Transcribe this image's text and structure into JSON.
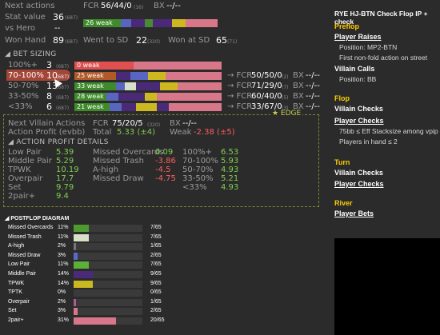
{
  "stats": {
    "next_actions_label": "Next actions",
    "stat_value_label": "Stat value",
    "stat_value": "36",
    "stat_value_sub": "(687)",
    "vs_hero_label": "vs Hero",
    "vs_hero_value": "--",
    "won_hand_label": "Won Hand",
    "won_hand_value": "89",
    "won_hand_sub": "(687)",
    "fcr_label": "FCR",
    "fcr_value": "56/44/0",
    "fcr_sub": "(16)",
    "bx_label": "BX",
    "bx_value": "--/--",
    "weak_bar_label": "26 weak",
    "went_sd_label": "Went to SD",
    "went_sd_value": "22",
    "went_sd_sub": "(320)",
    "won_sd_label": "Won at SD",
    "won_sd_value": "65",
    "won_sd_sub": "(71)"
  },
  "bet_sizing": {
    "title": "BET SIZING",
    "rows": [
      {
        "label": "100%+",
        "count": "3",
        "sub": "(687)",
        "bar_label": "0 weak",
        "fcr": "",
        "bx": ""
      },
      {
        "label": "70-100%",
        "count": "10",
        "sub": "(687)",
        "bar_label": "25 weak",
        "fcr_label": "→ FCR",
        "fcr": "50/50/0",
        "fcr_sub": "(2)",
        "bx_label": "BX",
        "bx": "--/--"
      },
      {
        "label": "50-70%",
        "count": "13",
        "sub": "(687)",
        "bar_label": "33 weak",
        "fcr_label": "→ FCR",
        "fcr": "71/29/0",
        "fcr_sub": "(7)",
        "bx_label": "BX",
        "bx": "--/--"
      },
      {
        "label": "33-50%",
        "count": "8",
        "sub": "(687)",
        "bar_label": "28 weak",
        "fcr_label": "→ FCR",
        "fcr": "60/40/0",
        "fcr_sub": "(5)",
        "bx_label": "BX",
        "bx": "--/--"
      },
      {
        "label": "<33%",
        "count": "6",
        "sub": "(687)",
        "bar_label": "21 weak",
        "fcr_label": "→ FCR",
        "fcr": "33/67/0",
        "fcr_sub": "(3)",
        "bx_label": "BX",
        "bx": "--/--"
      }
    ],
    "edge_label": "★ EDGE"
  },
  "villain_actions": {
    "next_label": "Next Villain Actions",
    "profit_label": "Action Profit (evbb)",
    "fcr_label": "FCR",
    "fcr_value": "75/20/5",
    "fcr_sub": "(320)",
    "bx_label": "BX",
    "bx_value": "--/--",
    "total_label": "Total",
    "total_value": "5.33 (±4)",
    "weak_label": "Weak",
    "weak_value": "-2.38 (±5)"
  },
  "profit_details": {
    "title": "ACTION PROFIT DETAILS",
    "col1": [
      {
        "label": "Low Pair",
        "value": "5.39",
        "color": "green"
      },
      {
        "label": "Middle Pair",
        "value": "5.29",
        "color": "green"
      },
      {
        "label": "TPWK",
        "value": "10.19",
        "color": "green"
      },
      {
        "label": "Overpair",
        "value": "17.7",
        "color": "green"
      },
      {
        "label": "Set",
        "value": "9.79",
        "color": "green"
      },
      {
        "label": "2pair+",
        "value": "9.4",
        "color": "green"
      }
    ],
    "col2": [
      {
        "label": "Missed Overcards",
        "value": "0.09",
        "color": "green"
      },
      {
        "label": "Missed Trash",
        "value": "-3.86",
        "color": "red"
      },
      {
        "label": "A-high",
        "value": "-4.5",
        "color": "red"
      },
      {
        "label": "Missed Draw",
        "value": "-4.75",
        "color": "red"
      }
    ],
    "col3": [
      {
        "label": "100%+",
        "value": "6.53",
        "color": "green"
      },
      {
        "label": "70-100%",
        "value": "5.93",
        "color": "green"
      },
      {
        "label": "50-70%",
        "value": "4.93",
        "color": "green"
      },
      {
        "label": "33-50%",
        "value": "5.21",
        "color": "green"
      },
      {
        "label": "<33%",
        "value": "4.93",
        "color": "green"
      }
    ]
  },
  "postflop": {
    "title": "POSTFLOP DIAGRAM",
    "rows": [
      {
        "label": "Missed Overcards",
        "pct": "11%",
        "fill": 0.22,
        "color": "#4f9a2e",
        "count": "7/65"
      },
      {
        "label": "Missed Trash",
        "pct": "11%",
        "fill": 0.22,
        "color": "#d7dfc9",
        "count": "7/65"
      },
      {
        "label": "A-high",
        "pct": "2%",
        "fill": 0.04,
        "color": "#777777",
        "count": "1/65"
      },
      {
        "label": "Missed Draw",
        "pct": "3%",
        "fill": 0.06,
        "color": "#5a6ac8",
        "count": "2/65"
      },
      {
        "label": "Low Pair",
        "pct": "11%",
        "fill": 0.22,
        "color": "#5bb03a",
        "count": "7/65"
      },
      {
        "label": "Middle Pair",
        "pct": "14%",
        "fill": 0.28,
        "color": "#4b2a7a",
        "count": "9/65"
      },
      {
        "label": "TPWK",
        "pct": "14%",
        "fill": 0.28,
        "color": "#c9b820",
        "count": "9/65"
      },
      {
        "label": "TPTK",
        "pct": "0%",
        "fill": 0.0,
        "color": "#777777",
        "count": "0/65"
      },
      {
        "label": "Overpair",
        "pct": "2%",
        "fill": 0.04,
        "color": "#b05a9a",
        "count": "1/65"
      },
      {
        "label": "Set",
        "pct": "3%",
        "fill": 0.06,
        "color": "#d9778a",
        "count": "2/65"
      },
      {
        "label": "2pair+",
        "pct": "31%",
        "fill": 0.62,
        "color": "#d9778a",
        "count": "20/65"
      }
    ]
  },
  "right_panel": {
    "title": "RYE HJ-BTN Check Flop IP + check",
    "preflop_header": "Preflop",
    "player_raises": "Player Raises",
    "position_mp2": "Position: MP2-BTN",
    "first_nonfold": "First non-fold action on street",
    "villain_calls": "Villain Calls",
    "position_bb": "Position: BB",
    "flop_header": "Flop",
    "villain_checks_flop": "Villain Checks",
    "player_checks_flop": "Player Checks",
    "stack_note": "75bb ≤ Eff Stacksize among vpip",
    "players_note": "Players in hand ≤ 2",
    "turn_header": "Turn",
    "villain_checks_turn": "Villain Checks",
    "player_checks_turn": "Player Checks",
    "river_header": "River",
    "player_bets": "Player Bets"
  },
  "colors": {
    "background": "#2b2b2b",
    "accent_yellow": "#ffcc00",
    "positive": "#7fd04f",
    "negative": "#ff5d5d"
  }
}
